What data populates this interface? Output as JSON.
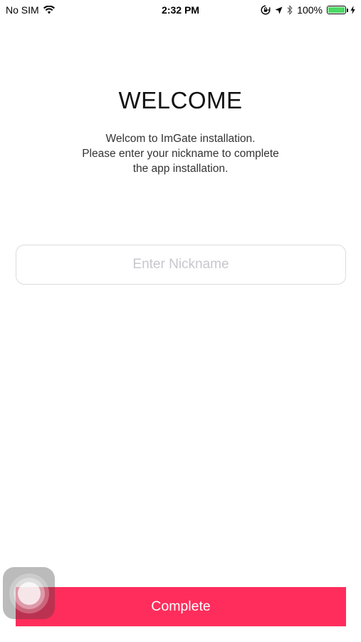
{
  "status_bar": {
    "carrier": "No SIM",
    "time": "2:32 PM",
    "battery_percent": "100%",
    "icons": [
      "wifi-icon",
      "orientation-lock-icon",
      "location-arrow-icon",
      "bluetooth-icon",
      "battery-icon",
      "charging-bolt-icon"
    ]
  },
  "welcome": {
    "title": "WELCOME",
    "lines": [
      "Welcom to ImGate installation.",
      "Please enter your nickname to complete",
      "the app installation."
    ]
  },
  "nickname": {
    "placeholder": "Enter Nickname",
    "value": ""
  },
  "actions": {
    "complete_label": "Complete"
  },
  "colors": {
    "accent": "#ff2d5c",
    "battery": "#4cd964",
    "placeholder": "#c7c7cd"
  }
}
